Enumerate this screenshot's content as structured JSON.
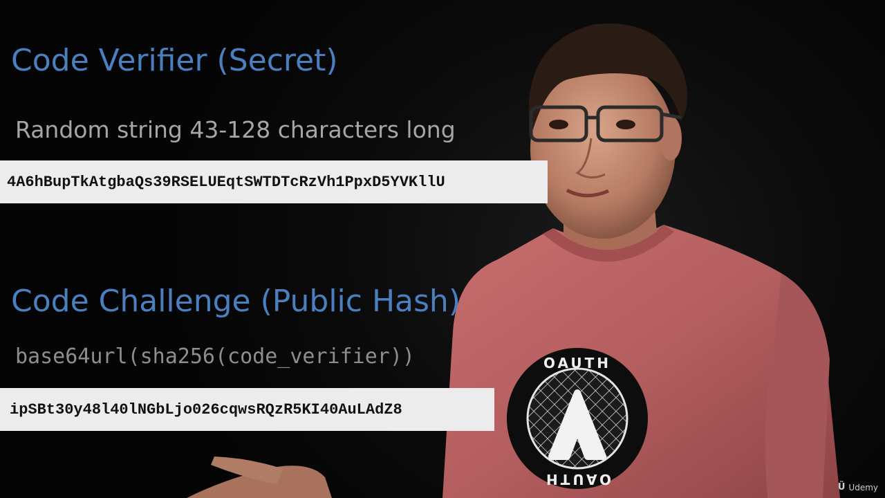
{
  "slide": {
    "verifier": {
      "title": "Code Verifier (Secret)",
      "description": "Random string 43-128 characters long",
      "example": "4A6hBupTkAtgbaQs39RSELUEqtSWTDTcRzVh1PpxD5YVKllU"
    },
    "challenge": {
      "title": "Code Challenge (Public Hash)",
      "formula": "base64url(sha256(code_verifier))",
      "example": "ipSBt30y48l40lNGbLjo026cqwsRQzR5KI40AuLAdZ8"
    }
  },
  "shirt_logo": {
    "top_text": "OAUTH",
    "bottom_text": "OAUTH"
  },
  "watermark": {
    "label": "Udemy",
    "icon": "udemy-logo-icon"
  },
  "colors": {
    "heading": "#4a7fc0",
    "shirt": "#b86262",
    "box": "#ececec"
  }
}
